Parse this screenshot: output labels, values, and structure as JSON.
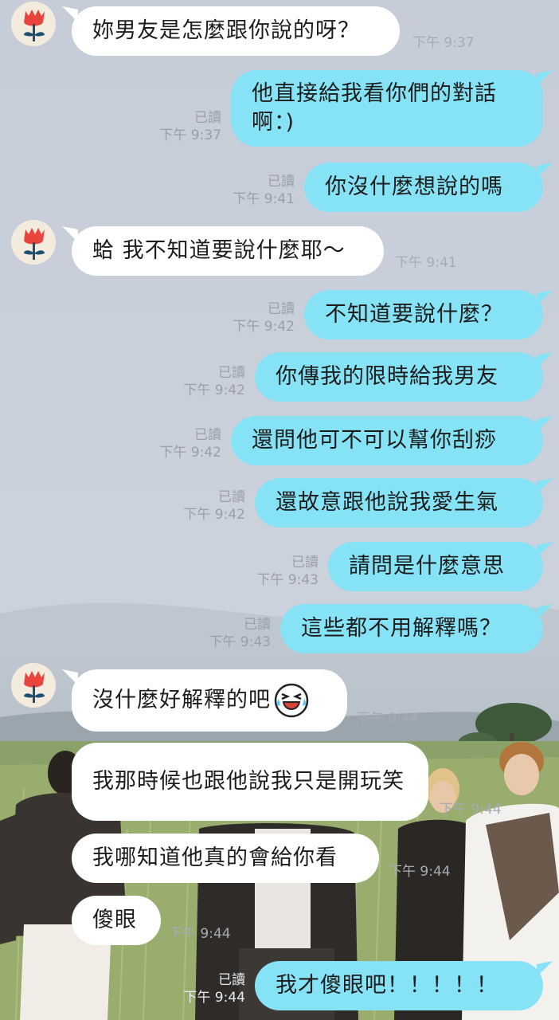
{
  "chat": {
    "messages": [
      {
        "id": "m1",
        "side": "in",
        "text": "妳男友是怎麼跟你說的呀？",
        "time": "下午 9:37"
      },
      {
        "id": "m2",
        "side": "out",
        "text": "他直接給我看你們的對話啊：)",
        "read": "已讀",
        "time": "下午 9:37"
      },
      {
        "id": "m3",
        "side": "out",
        "text": "你沒什麼想說的嗎",
        "read": "已讀",
        "time": "下午 9:41"
      },
      {
        "id": "m4",
        "side": "in",
        "text": "蛤 我不知道要說什麼耶～",
        "time": "下午 9:41"
      },
      {
        "id": "m5",
        "side": "out",
        "text": "不知道要說什麼？",
        "read": "已讀",
        "time": "下午 9:42"
      },
      {
        "id": "m6",
        "side": "out",
        "text": "你傳我的限時給我男友",
        "read": "已讀",
        "time": "下午 9:42"
      },
      {
        "id": "m7",
        "side": "out",
        "text": "還問他可不可以幫你刮痧",
        "read": "已讀",
        "time": "下午 9:42"
      },
      {
        "id": "m8",
        "side": "out",
        "text": "還故意跟他說我愛生氣",
        "read": "已讀",
        "time": "下午 9:42"
      },
      {
        "id": "m9",
        "side": "out",
        "text": "請問是什麼意思",
        "read": "已讀",
        "time": "下午 9:43"
      },
      {
        "id": "m10",
        "side": "out",
        "text": "這些都不用解釋嗎？",
        "read": "已讀",
        "time": "下午 9:43"
      },
      {
        "id": "m11",
        "side": "in",
        "text": "沒什麼好解釋的吧",
        "emoji": "crying-laughing-sticker-icon",
        "time": "下午 9:44"
      },
      {
        "id": "m12",
        "side": "in",
        "text": "我那時候也跟他說我只是開玩笑",
        "time": "下午 9:44"
      },
      {
        "id": "m13",
        "side": "in",
        "text": "我哪知道他真的會給你看",
        "time": "下午 9:44"
      },
      {
        "id": "m14",
        "side": "in",
        "text": "傻眼",
        "time": "下午 9:44"
      },
      {
        "id": "m15",
        "side": "out",
        "text": "我才傻眼吧！！！！！",
        "read": "已讀",
        "time": "下午 9:44"
      }
    ]
  },
  "colors": {
    "incoming_bubble": "#ffffff",
    "outgoing_bubble": "#86e2f5",
    "timestamp": "#9aa0aa",
    "avatar_flower": "#e9453c"
  },
  "avatar": {
    "icon": "red-tulip-avatar-icon"
  }
}
